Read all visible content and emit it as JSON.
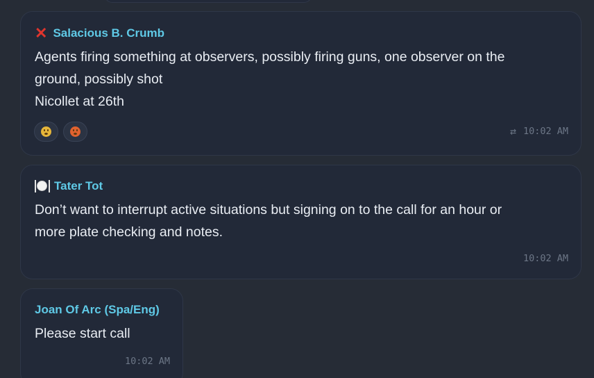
{
  "messages": [
    {
      "sender": "Salacious B. Crumb",
      "sender_icon": "cross-mark-icon",
      "lines": [
        "Agents firing something at observers, possibly firing guns, one observer on the",
        "ground, possibly shot",
        "Nicollet at 26th"
      ],
      "reactions": [
        {
          "icon": "anguished-face-icon"
        },
        {
          "icon": "angry-face-icon"
        }
      ],
      "repost_icon": "repost-icon",
      "time": "10:02 AM"
    },
    {
      "sender": "Tater Tot",
      "sender_icon": "fork-knife-plate-icon",
      "lines": [
        "Don’t want to interrupt active situations but signing on to the call for an hour or",
        "more plate checking and notes."
      ],
      "time": "10:02 AM"
    },
    {
      "sender": "Joan Of Arc (Spa/Eng)",
      "lines": [
        "Please start call"
      ],
      "time": "10:02 AM"
    }
  ],
  "colors": {
    "background": "#11151d",
    "bubble": "#222938",
    "sender": "#5fc9e6",
    "timestamp": "#6c7686"
  }
}
